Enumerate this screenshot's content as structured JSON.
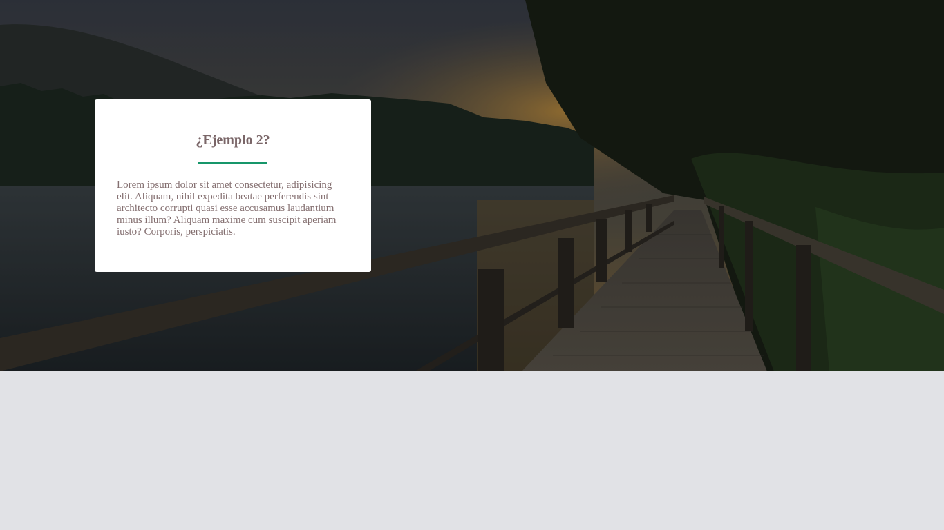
{
  "hero": {
    "image": "lake-boardwalk-sunset-forest"
  },
  "card": {
    "title": "¿Ejemplo 2?",
    "body": "Lorem ipsum dolor sit amet consectetur, adipisicing elit. Aliquam, nihil expedita beatae perferendis sint architecto corrupti quasi esse accusamus laudantium minus illum? Aliquam maxime cum suscipit aperiam iusto? Corporis, perspiciatis.",
    "accent_color": "#16966a",
    "text_color": "#846f70"
  },
  "page": {
    "background_color": "#e1e2e6"
  }
}
